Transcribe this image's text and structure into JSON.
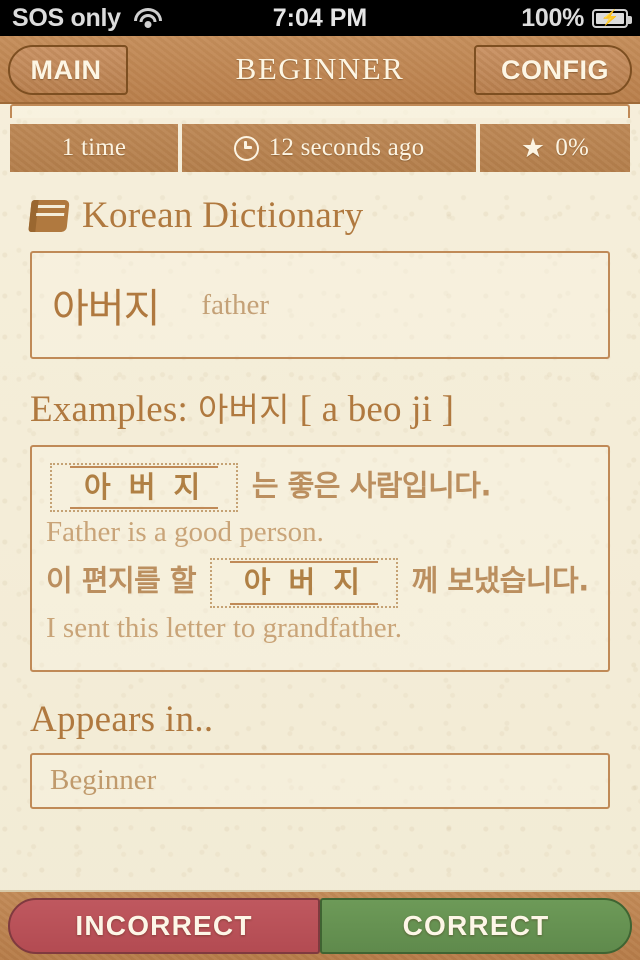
{
  "statusbar": {
    "carrier": "SOS only",
    "wifi_icon": "wifi-icon",
    "time": "7:04 PM",
    "battery_percent": "100%",
    "battery_icon": "battery-charging-icon"
  },
  "navbar": {
    "back_label": "MAIN",
    "title": "BEGINNER",
    "config_label": "CONFIG"
  },
  "stats": {
    "times_seen": "1 time",
    "clock_icon": "clock-icon",
    "last_seen": "12 seconds ago",
    "star_icon": "star-icon",
    "score": "0%"
  },
  "dictionary": {
    "book_icon": "book-icon",
    "title": "Korean Dictionary",
    "word": "아버지",
    "translation": "father"
  },
  "examples": {
    "heading_label": "Examples:",
    "heading_word": "아버지",
    "heading_romanization": "[ a beo ji ]",
    "items": [
      {
        "blank_word": "아 버 지",
        "kr_after": "는 좋은 사람입니다.",
        "kr_before": "",
        "en": "Father is a good person."
      },
      {
        "kr_before": "이 편지를 할",
        "blank_word": "아 버 지",
        "kr_after": "께 보냈습니다.",
        "en": "I sent this letter to grandfather."
      }
    ]
  },
  "appears_in": {
    "title": "Appears in..",
    "items": [
      "Beginner"
    ]
  },
  "footer": {
    "incorrect_label": "INCORRECT",
    "correct_label": "CORRECT"
  },
  "colors": {
    "paper": "#f3ecd8",
    "brown_bar": "#c0854f",
    "brown_border": "#7d4f21",
    "accent_text": "#b0793f",
    "incorrect_red": "#bb545c",
    "correct_green": "#689555"
  }
}
